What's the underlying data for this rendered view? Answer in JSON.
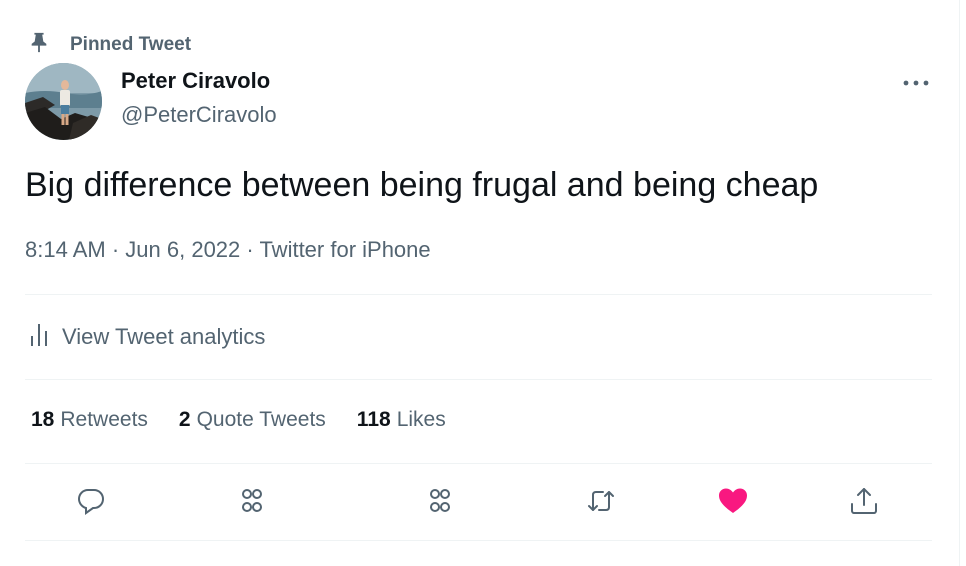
{
  "pinned": {
    "label": "Pinned Tweet",
    "icon": "pin-icon"
  },
  "author": {
    "name": "Peter Ciravolo",
    "handle": "@PeterCiravolo"
  },
  "tweet": {
    "text": "Big difference between being frugal and being cheap",
    "time": "8:14 AM",
    "date": "Jun 6, 2022",
    "source": "Twitter for iPhone"
  },
  "analytics": {
    "label": "View Tweet analytics",
    "icon": "bar-chart-icon"
  },
  "stats": {
    "retweets": {
      "count": "18",
      "label": "Retweets"
    },
    "quotes": {
      "count": "2",
      "label": "Quote Tweets"
    },
    "likes": {
      "count": "118",
      "label": "Likes"
    }
  },
  "actions": [
    {
      "name": "reply",
      "icon": "reply-icon"
    },
    {
      "name": "circles",
      "icon": "circles-icon"
    },
    {
      "name": "circles-2",
      "icon": "circles-icon"
    },
    {
      "name": "retweet",
      "icon": "retweet-icon"
    },
    {
      "name": "like",
      "icon": "heart-icon",
      "active": true,
      "color": "#f91880"
    },
    {
      "name": "share",
      "icon": "share-icon"
    }
  ],
  "colors": {
    "text_primary": "#0f1419",
    "text_secondary": "#536471",
    "divider": "#eff3f4",
    "like_active": "#f91880"
  }
}
